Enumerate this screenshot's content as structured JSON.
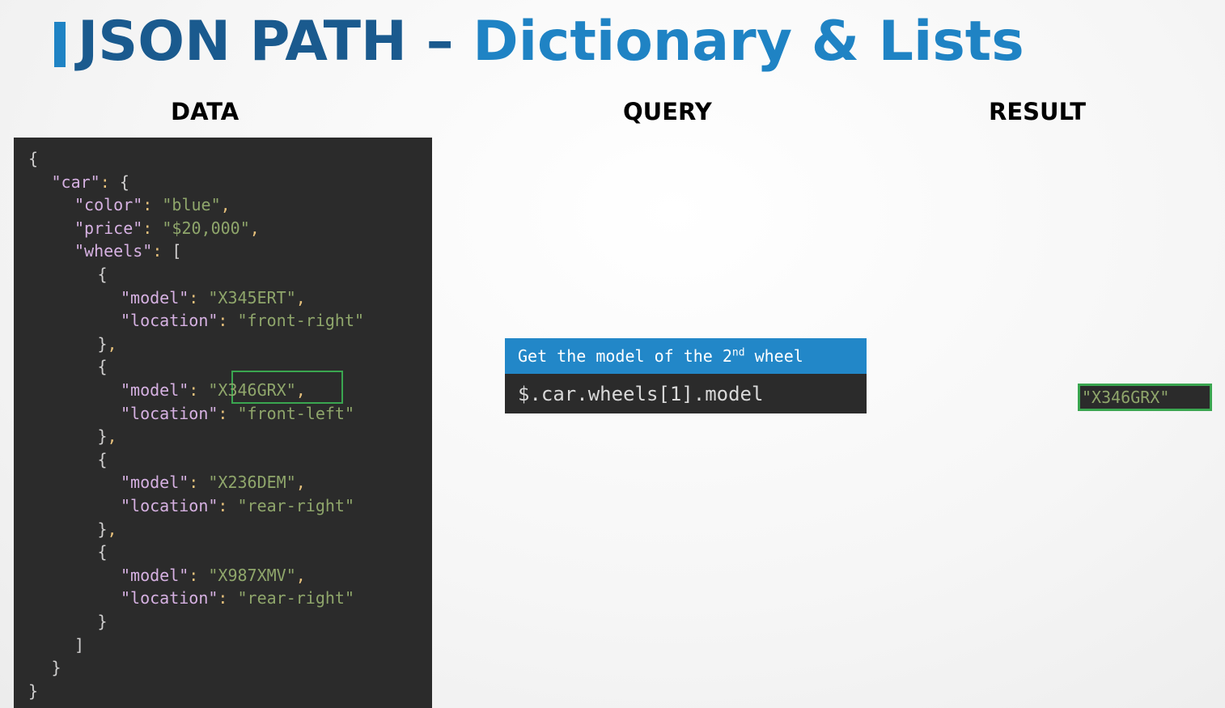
{
  "slide": {
    "title_main": "JSON PATH",
    "title_sep": "–",
    "title_sub": "Dictionary & Lists"
  },
  "columns": {
    "data": "DATA",
    "query": "QUERY",
    "result": "RESULT"
  },
  "code_lines": [
    {
      "indent": 0,
      "text": "{"
    },
    {
      "indent": 1,
      "text": "\"car\": {"
    },
    {
      "indent": 2,
      "text": "\"color\": \"blue\","
    },
    {
      "indent": 2,
      "text": "\"price\": \"$20,000\","
    },
    {
      "indent": 2,
      "text": "\"wheels\": ["
    },
    {
      "indent": 3,
      "text": "{"
    },
    {
      "indent": 4,
      "text": "\"model\": \"X345ERT\","
    },
    {
      "indent": 4,
      "text": "\"location\": \"front-right\""
    },
    {
      "indent": 3,
      "text": "},"
    },
    {
      "indent": 3,
      "text": "{"
    },
    {
      "indent": 4,
      "text": "\"model\": \"X346GRX\","
    },
    {
      "indent": 4,
      "text": "\"location\": \"front-left\""
    },
    {
      "indent": 3,
      "text": "},"
    },
    {
      "indent": 3,
      "text": "{"
    },
    {
      "indent": 4,
      "text": "\"model\": \"X236DEM\","
    },
    {
      "indent": 4,
      "text": "\"location\": \"rear-right\""
    },
    {
      "indent": 3,
      "text": "},"
    },
    {
      "indent": 3,
      "text": "{"
    },
    {
      "indent": 4,
      "text": "\"model\": \"X987XMV\","
    },
    {
      "indent": 4,
      "text": "\"location\": \"rear-right\""
    },
    {
      "indent": 3,
      "text": "}"
    },
    {
      "indent": 2,
      "text": "]"
    },
    {
      "indent": 1,
      "text": "}"
    },
    {
      "indent": 0,
      "text": "}"
    }
  ],
  "query": {
    "prompt_pre": "Get the model of the 2",
    "prompt_sup": "nd",
    "prompt_post": " wheel",
    "expression": "$.car.wheels[1].model"
  },
  "result": {
    "value": "\"X346GRX\""
  },
  "colors": {
    "title": "#1a5a8e",
    "accent_blue": "#2287c8",
    "panel_bg": "#2b2b2b",
    "highlight_green": "#3aa650",
    "string_green": "#8fa66b",
    "key_purple": "#d6b1e2"
  }
}
